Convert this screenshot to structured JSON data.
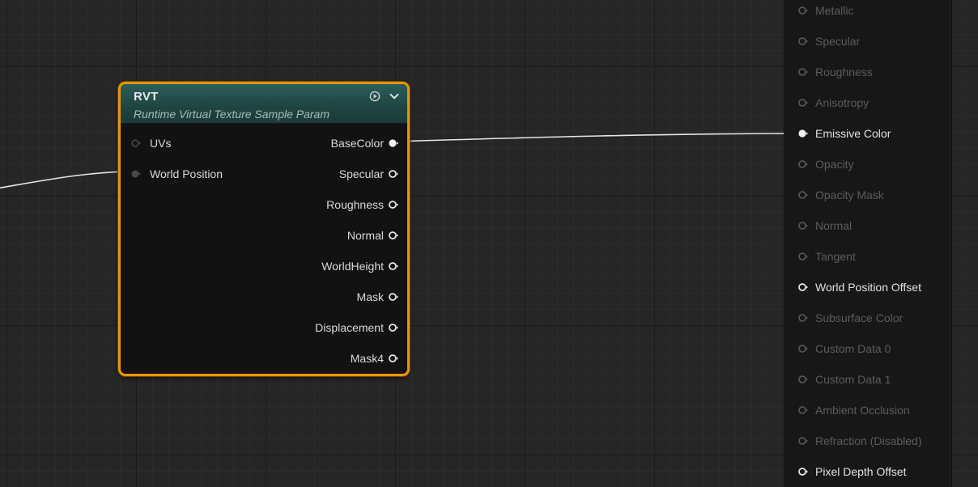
{
  "node": {
    "title": "RVT",
    "subtitle": "Runtime Virtual Texture Sample Param",
    "inputs": [
      {
        "label": "UVs",
        "connected": false
      },
      {
        "label": "World Position",
        "connected": true
      }
    ],
    "outputs": [
      {
        "label": "BaseColor",
        "connected": true
      },
      {
        "label": "Specular",
        "connected": false
      },
      {
        "label": "Roughness",
        "connected": false
      },
      {
        "label": "Normal",
        "connected": false
      },
      {
        "label": "WorldHeight",
        "connected": false
      },
      {
        "label": "Mask",
        "connected": false
      },
      {
        "label": "Displacement",
        "connected": false
      },
      {
        "label": "Mask4",
        "connected": false
      }
    ],
    "icons": {
      "preview": "play-icon",
      "collapse": "chevron-down-icon"
    }
  },
  "material_inputs": [
    {
      "label": "Metallic",
      "state": "inactive"
    },
    {
      "label": "Specular",
      "state": "inactive"
    },
    {
      "label": "Roughness",
      "state": "inactive"
    },
    {
      "label": "Anisotropy",
      "state": "inactive"
    },
    {
      "label": "Emissive Color",
      "state": "connected"
    },
    {
      "label": "Opacity",
      "state": "inactive"
    },
    {
      "label": "Opacity Mask",
      "state": "inactive"
    },
    {
      "label": "Normal",
      "state": "inactive"
    },
    {
      "label": "Tangent",
      "state": "inactive"
    },
    {
      "label": "World Position Offset",
      "state": "active"
    },
    {
      "label": "Subsurface Color",
      "state": "inactive"
    },
    {
      "label": "Custom Data 0",
      "state": "inactive"
    },
    {
      "label": "Custom Data 1",
      "state": "inactive"
    },
    {
      "label": "Ambient Occlusion",
      "state": "inactive"
    },
    {
      "label": "Refraction (Disabled)",
      "state": "inactive"
    },
    {
      "label": "Pixel Depth Offset",
      "state": "active"
    }
  ],
  "colors": {
    "node_border": "#e9950c",
    "node_header": "#1f4643",
    "wire": "#e6e6e6",
    "inactive_text": "#5c5c5c",
    "active_text": "#e2e2e2"
  }
}
